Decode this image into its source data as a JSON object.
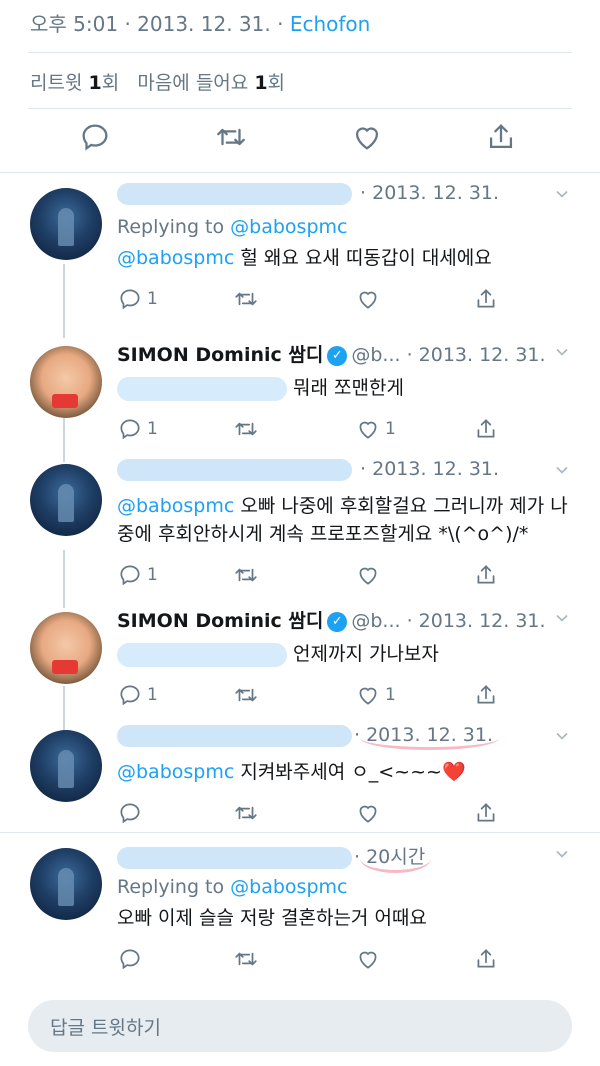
{
  "top": {
    "time": "오후 5:01",
    "sep": "·",
    "date": "2013. 12. 31.",
    "app": "Echofon"
  },
  "stats": {
    "retweets_label": "리트윗",
    "retweets_count": "1",
    "retweets_suffix": "회",
    "likes_label": "마음에 들어요",
    "likes_count": "1",
    "likes_suffix": "회"
  },
  "tweets": [
    {
      "date": "· 2013. 12. 31.",
      "reply_prefix": "Replying to ",
      "reply_handle": "@babospmc",
      "mention": "@babospmc",
      "text": " 헐 왜요 요새 띠동갑이 대세에요",
      "reply_count": "1",
      "retweet_count": "",
      "like_count": ""
    },
    {
      "name": "SIMON Dominic 쌈디",
      "verified_mark": "✓",
      "handle": "@b...",
      "date": "· 2013. 12. 31.",
      "text": "뭐래 쪼맨한게",
      "reply_count": "1",
      "retweet_count": "",
      "like_count": "1"
    },
    {
      "date": "· 2013. 12. 31.",
      "mention": "@babospmc",
      "text": " 오빠 나중에 후회할걸요 그러니까 제가 나중에 후회안하시게 계속 프로포즈할게요 *\\(^o^)/*",
      "reply_count": "1",
      "retweet_count": "",
      "like_count": ""
    },
    {
      "name": "SIMON Dominic 쌈디",
      "verified_mark": "✓",
      "handle": "@b...",
      "date": "· 2013. 12. 31.",
      "text": "언제까지 가나보자",
      "reply_count": "1",
      "retweet_count": "",
      "like_count": "1"
    },
    {
      "date": "2013. 12. 31.",
      "date_sep": "· ",
      "mention": "@babospmc",
      "text": " 지켜봐주세여 ㅇ_<~~~",
      "heart": "❤️",
      "reply_count": "",
      "retweet_count": "",
      "like_count": ""
    },
    {
      "date": "20시간",
      "date_sep": "· ",
      "reply_prefix": "Replying to ",
      "reply_handle": "@babospmc",
      "text": "오빠 이제 슬슬 저랑 결혼하는거 어때요",
      "reply_count": "",
      "retweet_count": "",
      "like_count": ""
    }
  ],
  "compose": {
    "placeholder": "답글 트윗하기"
  },
  "colors": {
    "accent": "#1da1f2",
    "muted": "#657786",
    "divider": "#e1e8ed",
    "heart": "#e0245e"
  },
  "icons": [
    "reply-icon",
    "retweet-icon",
    "like-icon",
    "share-icon",
    "chevron-down-icon",
    "verified-icon"
  ]
}
